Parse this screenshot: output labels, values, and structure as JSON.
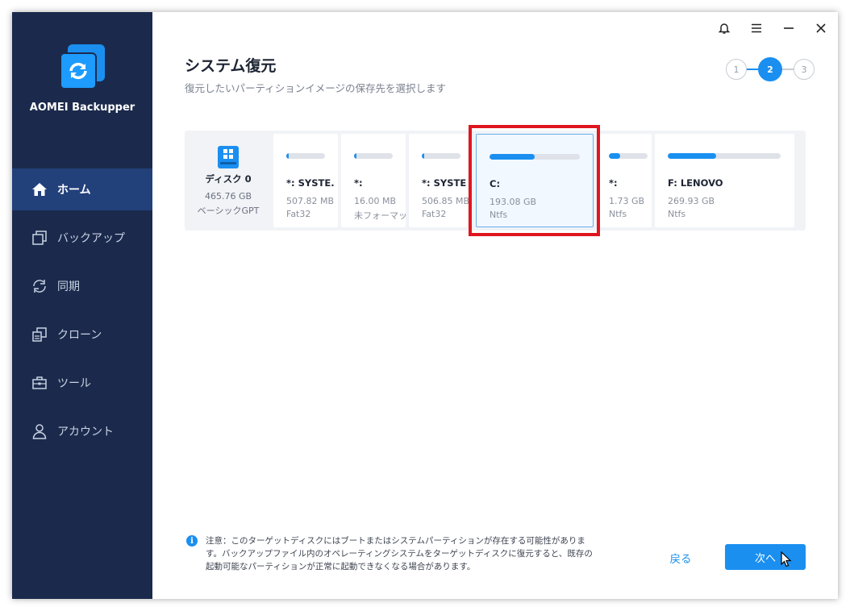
{
  "app": {
    "name": "AOMEI Backupper"
  },
  "sidebar": {
    "items": [
      {
        "label": "ホーム",
        "icon": "home-icon",
        "active": true
      },
      {
        "label": "バックアップ",
        "icon": "backup-icon",
        "active": false
      },
      {
        "label": "同期",
        "icon": "sync-icon",
        "active": false
      },
      {
        "label": "クローン",
        "icon": "clone-icon",
        "active": false
      },
      {
        "label": "ツール",
        "icon": "tools-icon",
        "active": false
      },
      {
        "label": "アカウント",
        "icon": "account-icon",
        "active": false
      }
    ]
  },
  "window_controls": [
    "bell-icon",
    "menu-icon",
    "minimize-icon",
    "close-icon"
  ],
  "page": {
    "title": "システム復元",
    "subtitle": "復元したいパーティションイメージの保存先を選択します"
  },
  "steps": {
    "items": [
      "1",
      "2",
      "3"
    ],
    "current": 2
  },
  "disk": {
    "name": "ディスク 0",
    "size": "465.76 GB",
    "style": "ベーシックGPT",
    "partitions": [
      {
        "name": "*: SYSTE...",
        "size": "507.82 MB",
        "fs": "Fat32",
        "used": 0.06,
        "selected": false
      },
      {
        "name": "*:",
        "size": "16.00 MB",
        "fs": "未フォーマット",
        "used": 0.06,
        "selected": false
      },
      {
        "name": "*: SYSTE...",
        "size": "506.85 MB",
        "fs": "Fat32",
        "used": 0.06,
        "selected": false
      },
      {
        "name": "C:",
        "size": "193.08 GB",
        "fs": "Ntfs",
        "used": 0.5,
        "selected": true
      },
      {
        "name": "*:",
        "size": "1.73 GB",
        "fs": "Ntfs",
        "used": 0.3,
        "selected": false
      },
      {
        "name": "F: LENOVO",
        "size": "269.93 GB",
        "fs": "Ntfs",
        "used": 0.43,
        "selected": false
      }
    ]
  },
  "note": {
    "text": "注意：このターゲットディスクにはブートまたはシステムパーティションが存在する可能性があります。バックアップファイル内のオペレーティングシステムをターゲットディスクに復元すると、既存の起動可能なパーティションが正常に起動できなくなる場合があります。"
  },
  "buttons": {
    "back": "戻る",
    "next": "次へ"
  },
  "colors": {
    "accent": "#1a8ff0",
    "sidebar": "#1b2a4c",
    "highlight": "#e0161e"
  }
}
